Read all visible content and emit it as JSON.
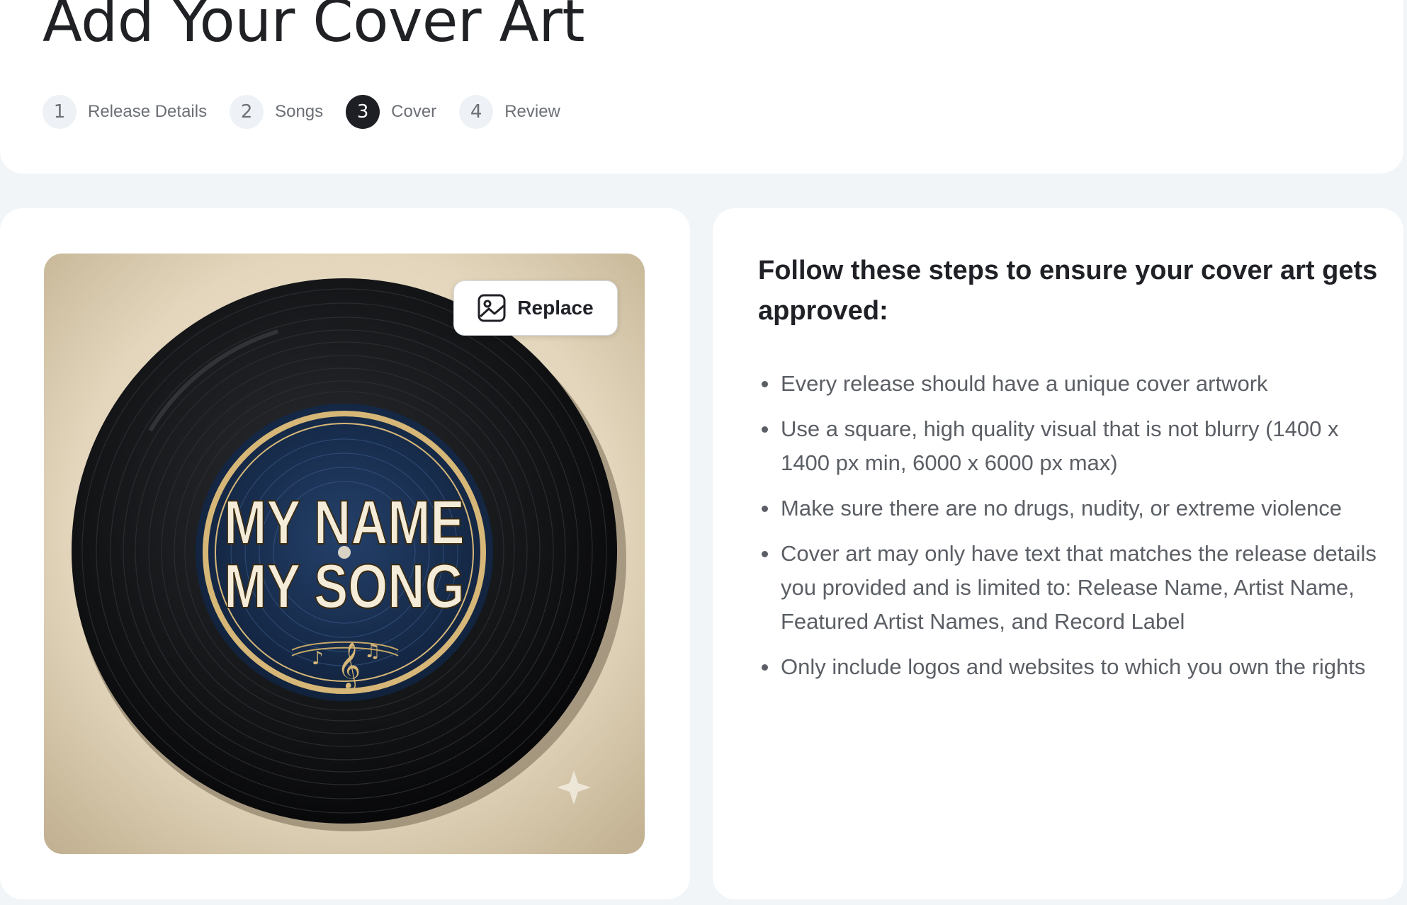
{
  "page": {
    "title": "Add Your Cover Art"
  },
  "stepper": {
    "steps": [
      {
        "number": "1",
        "label": "Release Details",
        "state": "completed"
      },
      {
        "number": "2",
        "label": "Songs",
        "state": "completed"
      },
      {
        "number": "3",
        "label": "Cover",
        "state": "active"
      },
      {
        "number": "4",
        "label": "Review",
        "state": "upcoming"
      }
    ]
  },
  "cover": {
    "artwork_line1": "MY NAME",
    "artwork_line2": "MY SONG",
    "replace_label": "Replace",
    "replace_icon": "image-icon"
  },
  "guidelines": {
    "title": "Follow these steps to ensure your cover art gets approved:",
    "items": [
      "Every release should have a unique cover artwork",
      "Use a square, high quality visual that is not blurry (1400 x 1400 px min, 6000 x 6000 px max)",
      "Make sure there are no drugs, nudity, or extreme violence",
      "Cover art may only have text that matches the release details you provided and is limited to: Release Name, Artist Name, Featured Artist Names, and Record Label",
      "Only include logos and websites to which you own the rights"
    ]
  },
  "colors": {
    "background": "#f1f5f8",
    "card": "#ffffff",
    "active_step": "#1d1f24",
    "inactive_step": "#eef2f6",
    "text_primary": "#1f2126",
    "text_secondary": "#5b5f65"
  }
}
